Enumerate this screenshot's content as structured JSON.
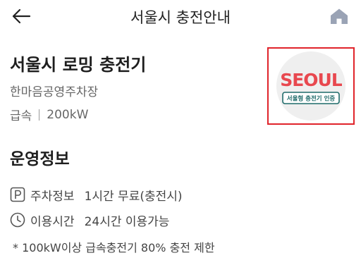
{
  "header": {
    "title": "서울시 충전안내",
    "back_icon": "arrow-left-icon",
    "home_icon": "home-icon",
    "home_icon_color": "#9aa3b5"
  },
  "station": {
    "name": "서울시 로밍 충전기",
    "place": "한마음공영주차장",
    "speed": "급속",
    "power": "200kW"
  },
  "logo": {
    "wordmark": "SEOUL",
    "badge_text": "서울형 충전기 인증",
    "frame_color": "#e0242b",
    "wordmark_color": "#e8484f",
    "badge_color": "#1f6b6a"
  },
  "operation": {
    "section_title": "운영정보",
    "rows": [
      {
        "icon": "parking-icon",
        "label": "주차정보",
        "value": "1시간 무료(충전시)"
      },
      {
        "icon": "clock-icon",
        "label": "이용시간",
        "value": "24시간 이용가능"
      }
    ],
    "note": "* 100kW이상 급속충전기 80% 충전 제한"
  }
}
